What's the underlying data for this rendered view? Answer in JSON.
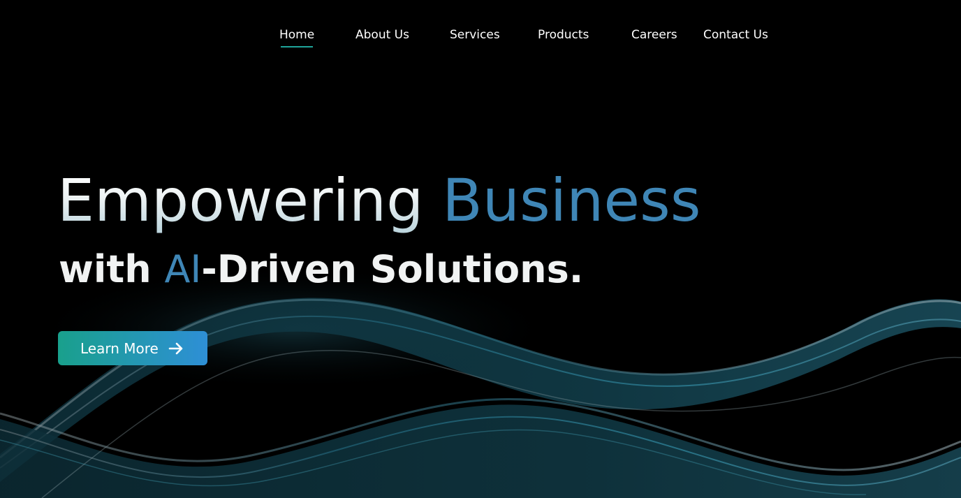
{
  "nav": {
    "items": [
      {
        "label": "Home",
        "active": true
      },
      {
        "label": "About Us"
      },
      {
        "label": "Services"
      },
      {
        "label": "Products"
      },
      {
        "label": "Careers"
      },
      {
        "label": "Contact Us"
      }
    ]
  },
  "hero": {
    "title_part1": "Empowering",
    "title_part2": "Business",
    "subtitle_prefix": "with ",
    "subtitle_highlight": "AI",
    "subtitle_suffix": "-Driven Solutions.",
    "cta_label": "Learn More",
    "cta_icon": "arrow-right-icon"
  },
  "colors": {
    "background": "#000000",
    "accent_blue": "#3f86b6",
    "active_underline": "#1fa59a",
    "button_gradient_start": "#19a08c",
    "button_gradient_end": "#2e8fd6"
  }
}
